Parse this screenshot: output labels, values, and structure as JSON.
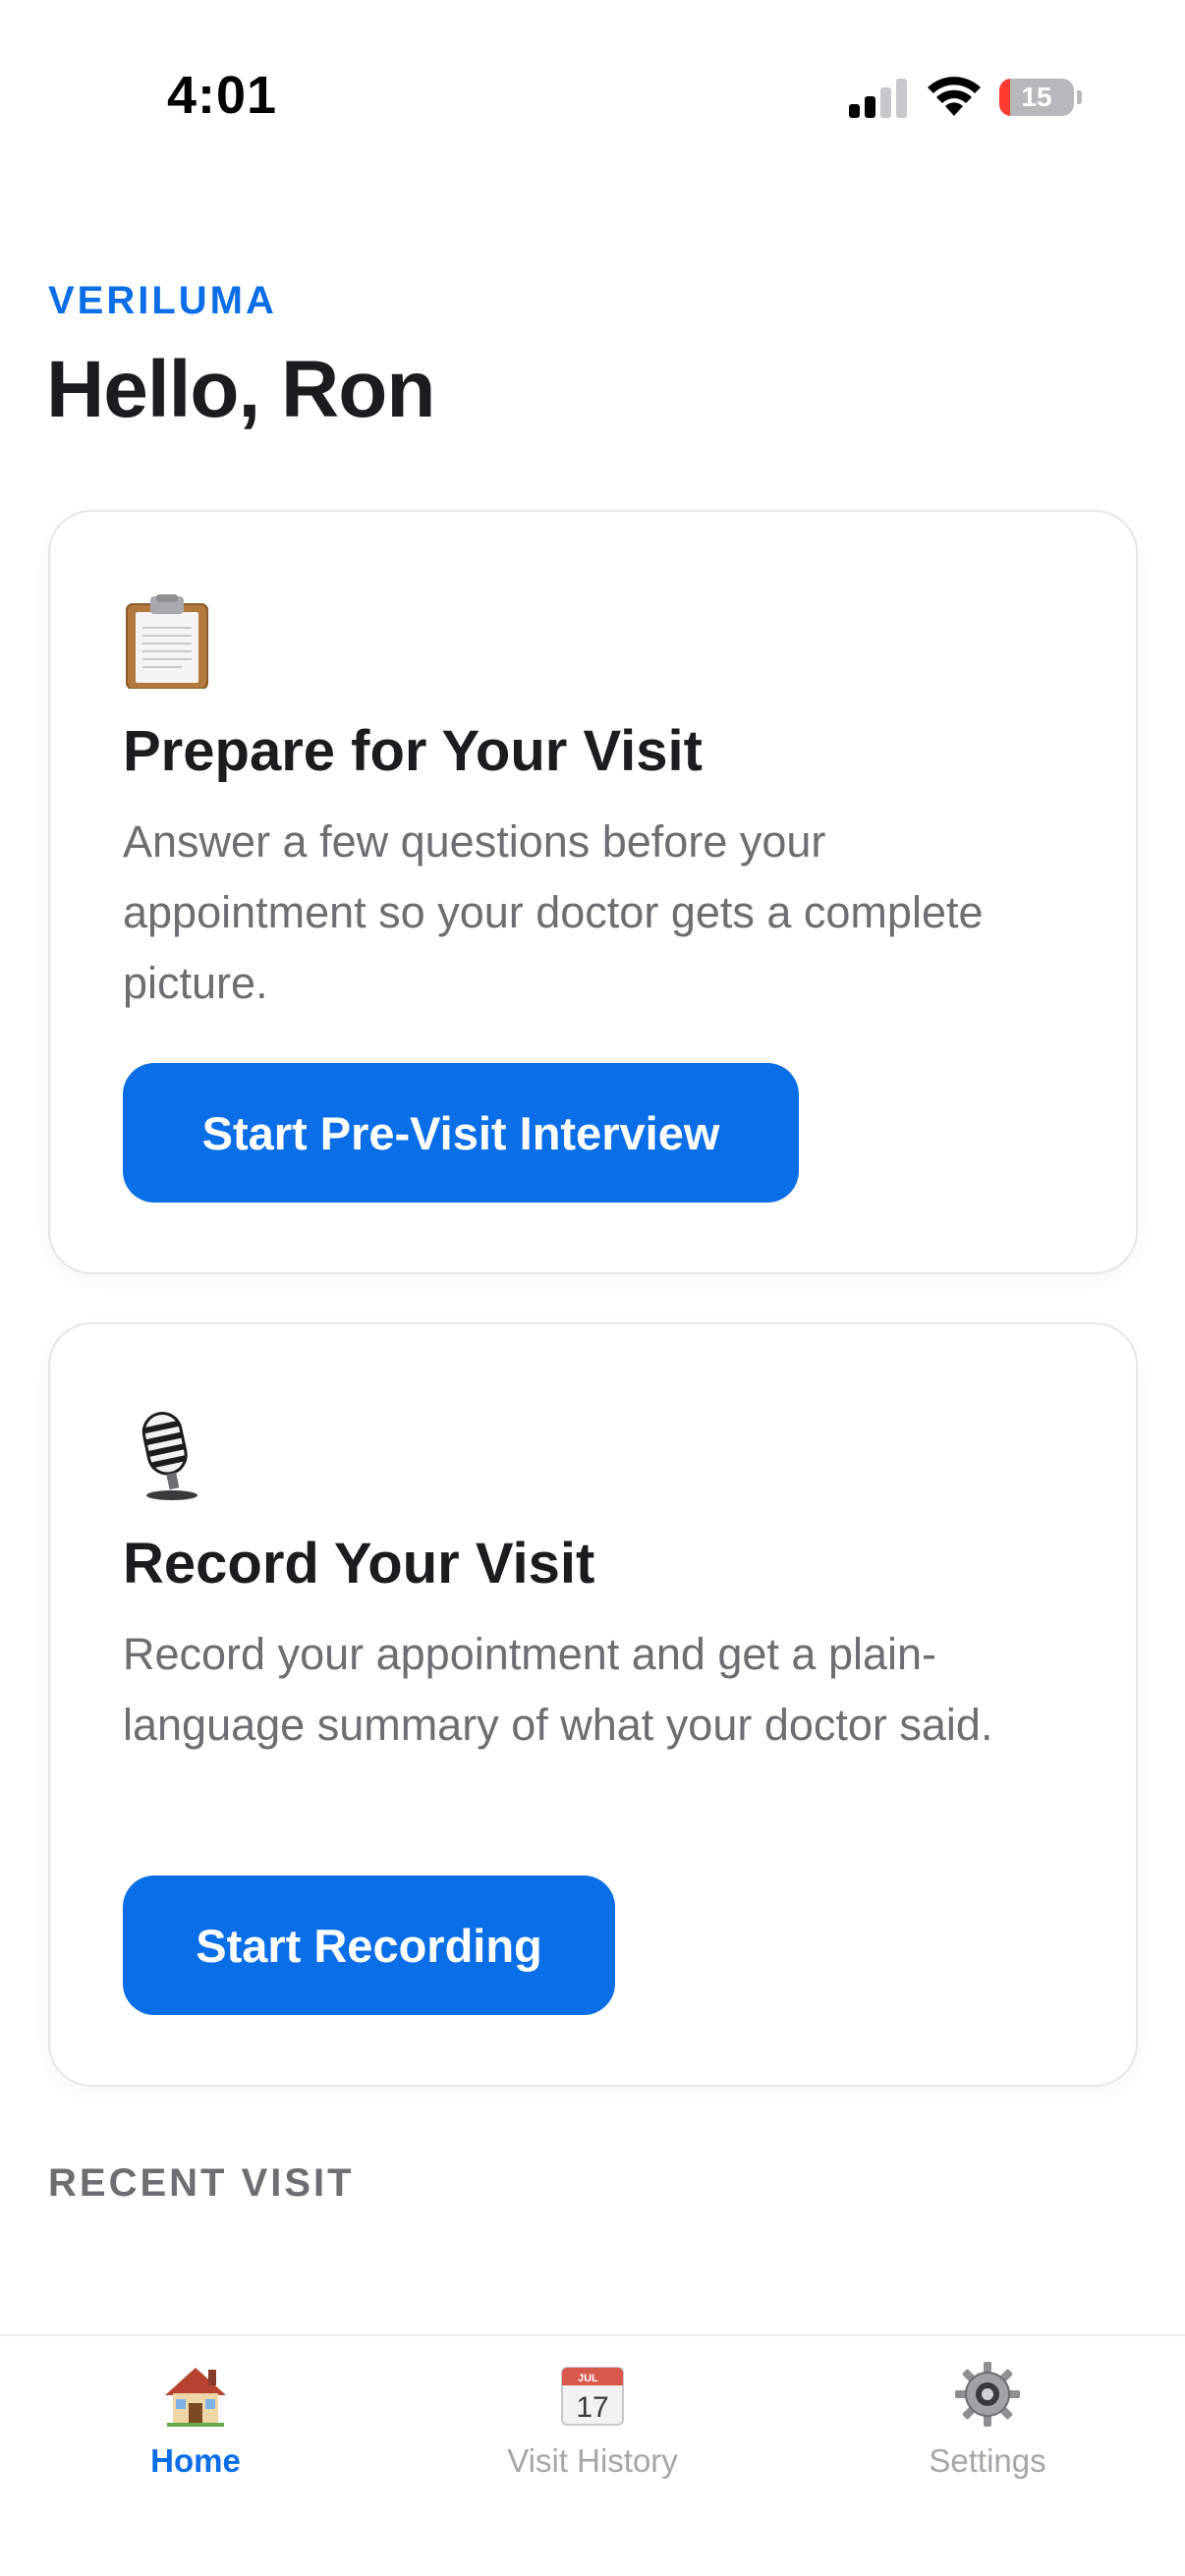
{
  "status_bar": {
    "time": "4:01",
    "battery_level": "15",
    "battery_fraction": 0.15
  },
  "header": {
    "brand": "VERILUMA",
    "greeting": "Hello, Ron"
  },
  "cards": [
    {
      "icon": "clipboard-icon",
      "title": "Prepare for Your Visit",
      "description": "Answer a few questions before your appointment so your doctor gets a complete picture.",
      "button_label": "Start Pre-Visit Interview"
    },
    {
      "icon": "microphone-icon",
      "title": "Record Your Visit",
      "description": "Record your appointment and get a plain-language summary of what your doctor said.",
      "button_label": "Start Recording"
    }
  ],
  "recent_visit": {
    "section_label": "RECENT VISIT"
  },
  "tab_bar": {
    "items": [
      {
        "label": "Home",
        "icon": "house-icon",
        "active": true
      },
      {
        "label": "Visit History",
        "icon": "calendar-icon",
        "active": false,
        "calendar_month": "JUL",
        "calendar_day": "17"
      },
      {
        "label": "Settings",
        "icon": "gear-icon",
        "active": false
      }
    ]
  },
  "colors": {
    "accent": "#0a6ee6",
    "text_primary": "#1c1c1e",
    "text_secondary": "#6d6d72",
    "tab_inactive": "#a5a5aa",
    "battery_low": "#ff3b30"
  }
}
